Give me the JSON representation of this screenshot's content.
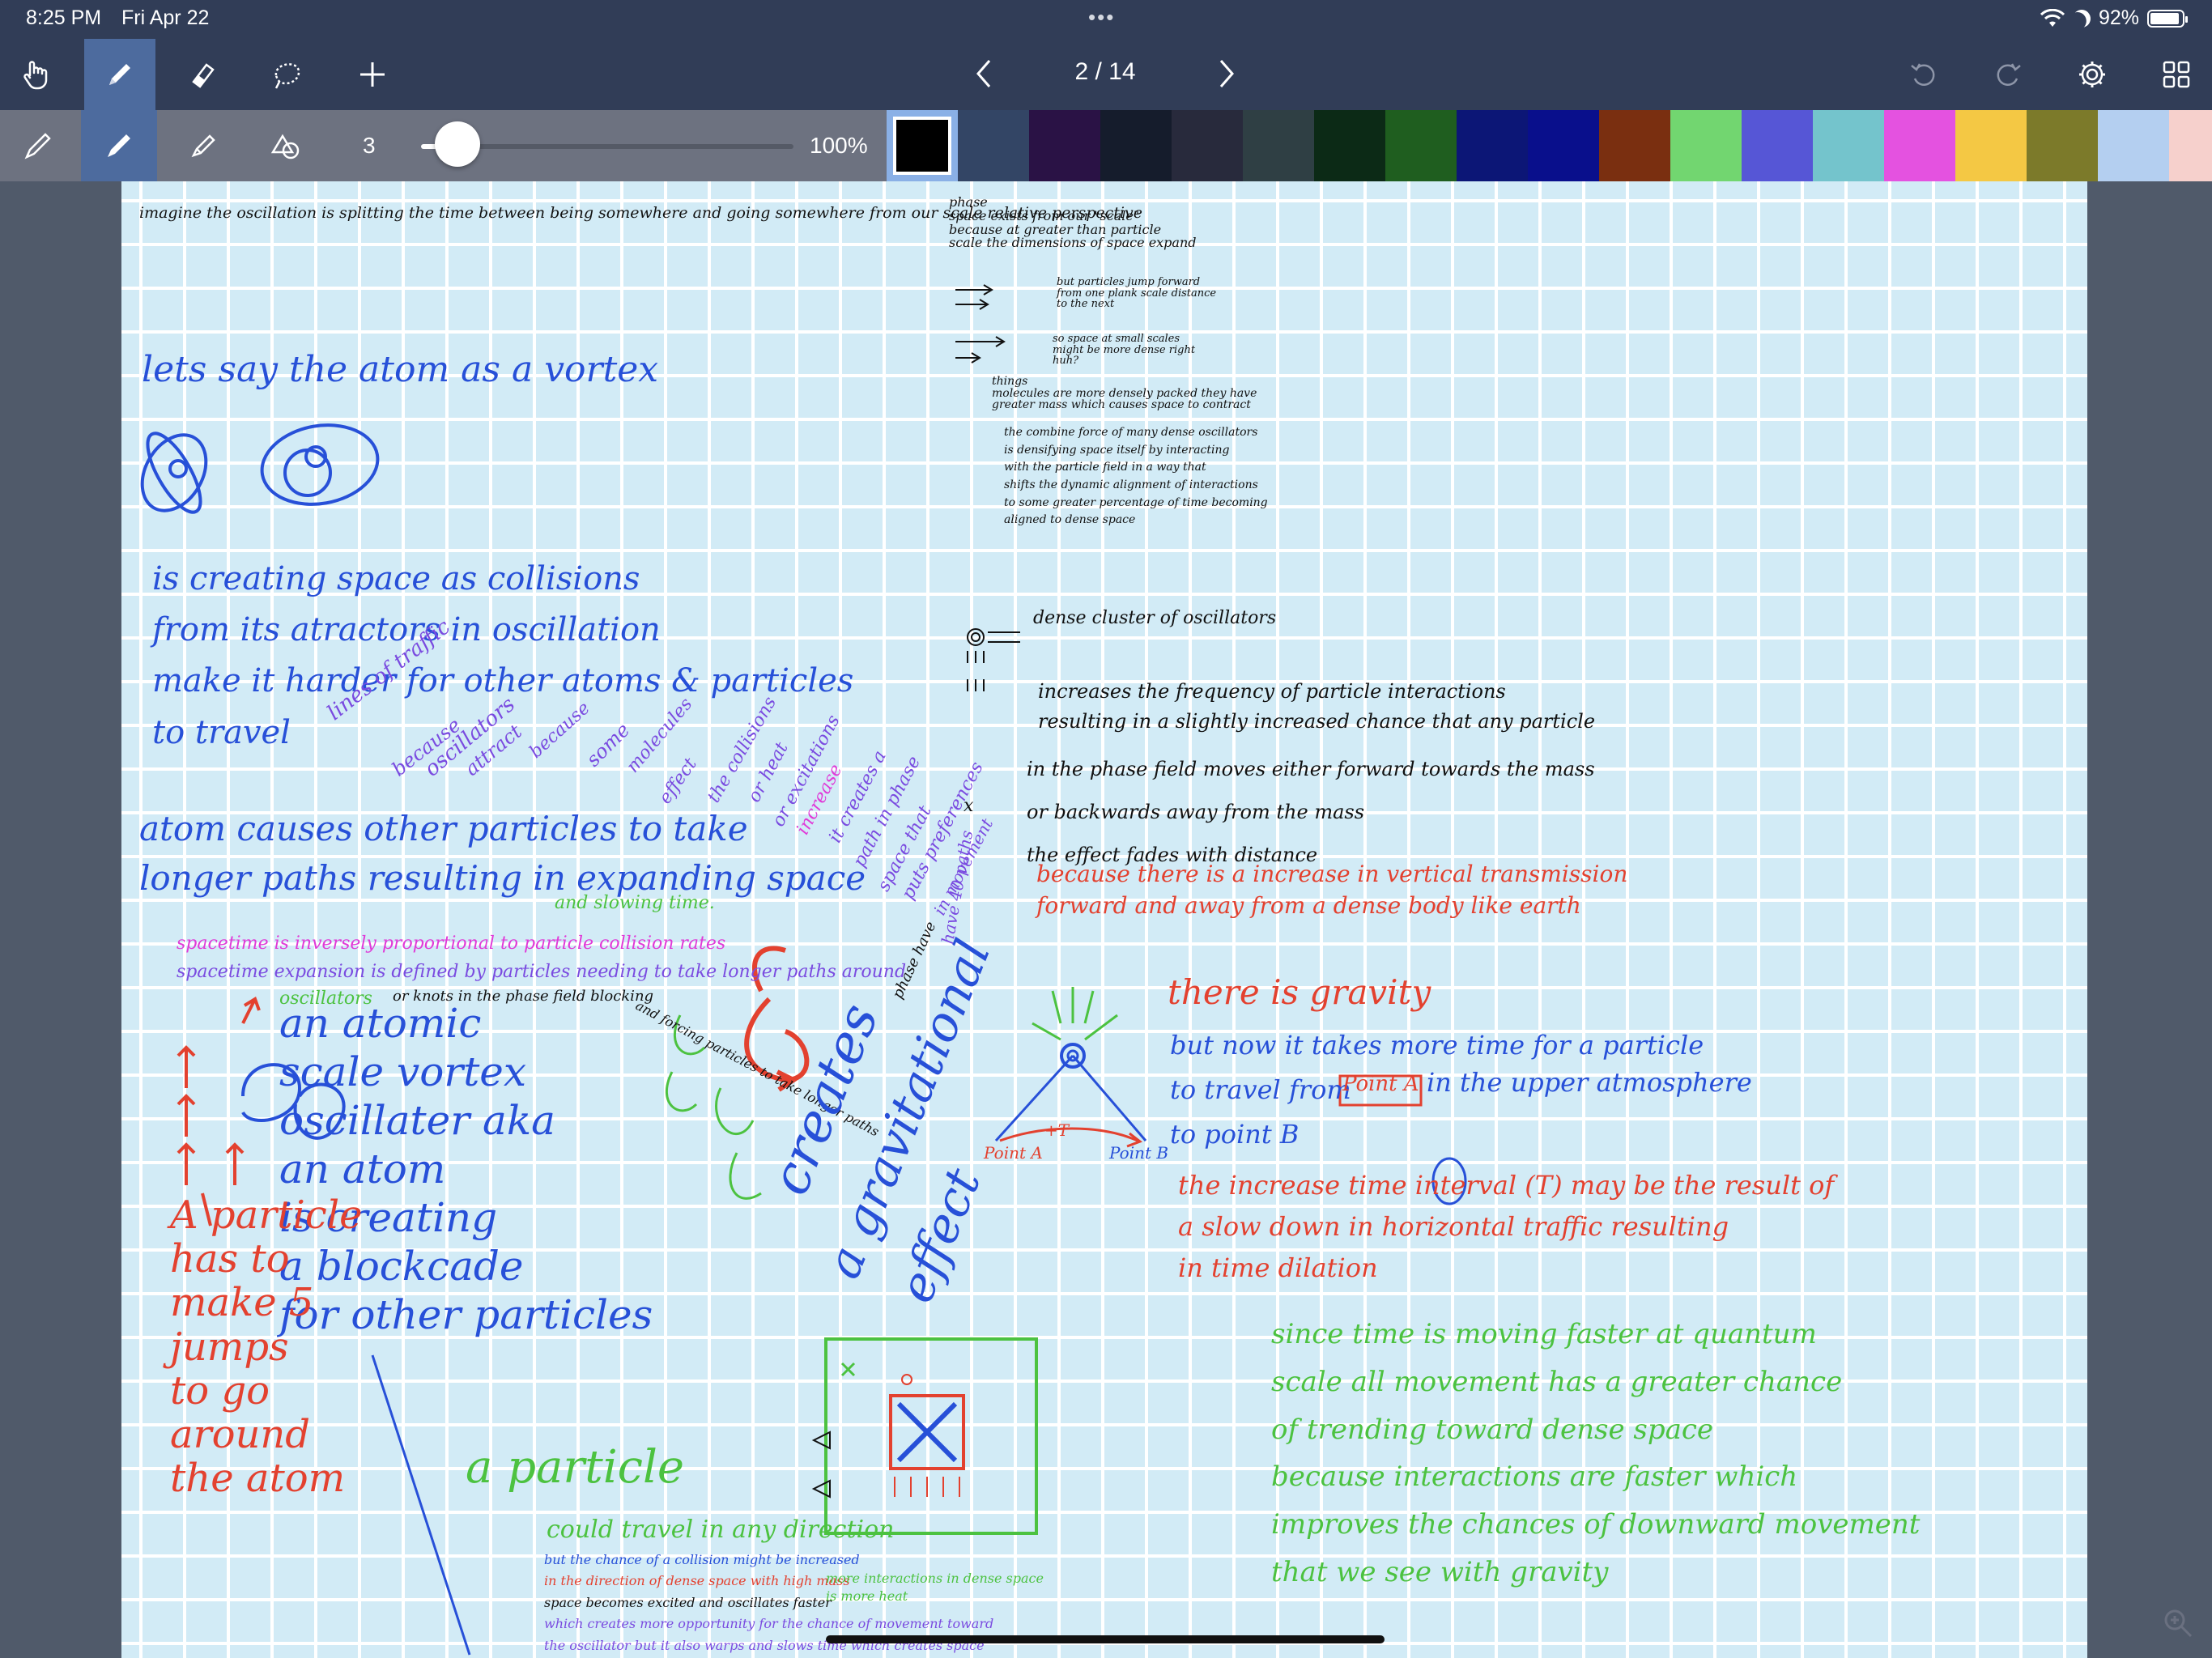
{
  "status_bar": {
    "time": "8:25 PM",
    "date": "Fri Apr 22",
    "multitask_dots": "•••",
    "battery_percent": "92%",
    "battery_level": 0.92
  },
  "toolbar": {
    "tools": [
      "hand-icon",
      "pen-icon",
      "eraser-icon",
      "lasso-icon",
      "plus-icon"
    ],
    "active_tool": "pen",
    "page_indicator": "2 / 14",
    "right_tools": [
      "undo-icon",
      "redo-icon",
      "gear-icon",
      "grid-icon"
    ]
  },
  "pen_bar": {
    "pen_types": [
      "fountain-pen-icon",
      "ballpoint-pen-icon",
      "brush-pen-icon",
      "shapes-icon"
    ],
    "active_pen": "ballpoint",
    "size_value": "3",
    "size_level": 0.08,
    "opacity": "100%",
    "colors": [
      "#000000",
      "#334565",
      "#2a1245",
      "#151c2c",
      "#282a3c",
      "#2f3f44",
      "#0c2a16",
      "#1f5e1f",
      "#0c1676",
      "#090f8c",
      "#7a2f10",
      "#72d670",
      "#5656d6",
      "#74c4cc",
      "#e452e0",
      "#f4c844",
      "#7c7a2a",
      "#b4cff0",
      "#f6d0cc"
    ],
    "selected_color": "#000000"
  },
  "notes": {
    "top_black": "imagine the oscillation is splitting the time between being somewhere and going somewhere from our scale relative perspective",
    "side_black": [
      "phase",
      "space exists from our \"scale\"",
      "because at greater than particle",
      "scale the dimensions of space expand"
    ],
    "arrows_note": [
      "but particles jump forward",
      "from one plank scale distance",
      "to the next"
    ],
    "small_scales": [
      "so space at small scales",
      "might be more dense right",
      "huh?"
    ],
    "dense_note": [
      "things",
      "molecules are more densely packed they have",
      "greater mass which causes space to contract"
    ],
    "combine_note": [
      "the combine force of many dense oscillators",
      "is densifying space itself by interacting",
      "with the particle field in a way that",
      "shifts the dynamic alignment of interactions",
      "to some greater percentage of time becoming",
      "aligned to dense space"
    ],
    "vortex_title": "lets say the atom as a vortex",
    "creating_space": [
      "is creating space as collisions",
      "from its atractors in oscillation",
      "make it harder for other atoms & particles",
      "to travel"
    ],
    "atom_causes": [
      "atom causes other particles to take",
      "longer paths resulting in expanding space"
    ],
    "slowing_time": "and slowing time.",
    "diagonal_lines": [
      "lines of traffic",
      "because",
      "oscillators",
      "attract",
      "because",
      "some",
      "molecules",
      "effect",
      "the collisions",
      "or heat",
      "or excitations",
      "increase",
      "it creates a",
      "path in phase",
      "space that",
      "puts preferences",
      "in movement",
      "x",
      "have 40 paths"
    ],
    "spacetime_pink": "spacetime is inversely proportional to particle collision rates",
    "spacetime_violet": "spacetime expansion is defined by particles needing to take longer paths around",
    "oscillators_green": "oscillators",
    "or_knots": "or knots in the phase field blocking",
    "and_forcing": "and forcing particles to take longer paths",
    "phase_have": "phase have",
    "vortex_blue": [
      "an atomic",
      "scale vortex",
      "oscillater aka",
      "an atom",
      "is creating",
      "a blockcade",
      "for other particles"
    ],
    "a_particle_green": "a particle",
    "particle_red": [
      "A particle",
      "has to",
      "make 5",
      "jumps",
      "to go",
      "around",
      "the atom"
    ],
    "creates_gravity": [
      "creates",
      "a gravitational",
      "effect"
    ],
    "could_travel": "could travel in any direction",
    "bottom_notes": [
      "but the chance of a collision might be increased",
      "in the direction of dense space with high mass",
      "space becomes excited and oscillates faster",
      "which creates more opportunity for the chance of movement toward",
      "the oscillator but it also warps and slows time which creates space"
    ],
    "more_interactions": [
      "more interactions in dense space",
      "is more heat"
    ],
    "dense_cluster": "dense cluster of oscillators",
    "increases": [
      "increases the frequency of particle interactions",
      "resulting in a slightly increased chance that any particle"
    ],
    "phase_field": [
      "in the phase field moves either forward towards the mass",
      "or backwards away from the mass",
      "the effect fades with distance"
    ],
    "because_red": [
      "because there is a increase in vertical transmission",
      "forward and away from a dense body like earth"
    ],
    "there_is_gravity": "there is gravity",
    "but_now": [
      "but now it takes more time for a particle",
      "to travel from",
      "to point B"
    ],
    "point_a_red": "Point A",
    "in_upper": "in the upper atmosphere",
    "diagram_labels": [
      "Point A",
      "Point B",
      "+T"
    ],
    "increase_time": [
      "the increase time interval (T) may be the result of",
      "a slow down in horizontal traffic resulting",
      "in time dilation"
    ],
    "green_bottom": [
      "since time is moving faster at quantum",
      "scale all movement has a greater chance",
      "of trending toward dense space",
      "because interactions are faster which",
      "improves the chances of downward movement",
      "that we see with gravity"
    ]
  }
}
